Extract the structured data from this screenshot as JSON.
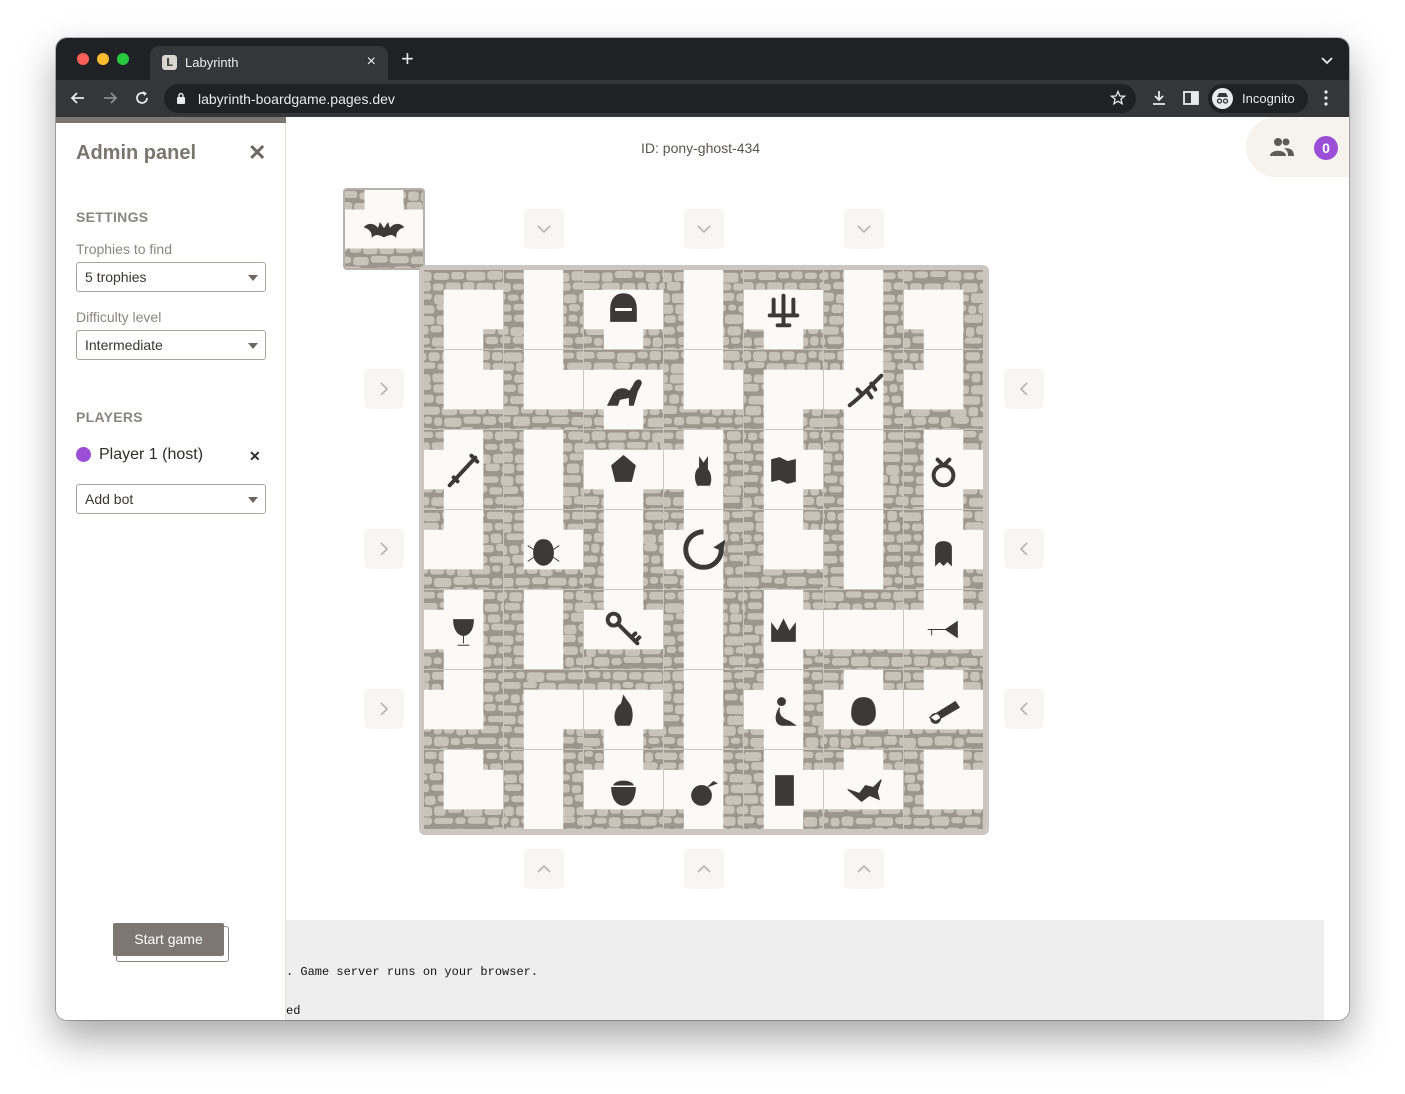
{
  "browser": {
    "tab_title": "Labyrinth",
    "tab_favicon": "L",
    "url": "labyrinth-boardgame.pages.dev",
    "profile_label": "Incognito"
  },
  "admin_panel": {
    "title": "Admin panel",
    "settings_heading": "SETTINGS",
    "trophies_label": "Trophies to find",
    "trophies_value": "5 trophies",
    "difficulty_label": "Difficulty level",
    "difficulty_value": "Intermediate",
    "players_heading": "PLAYERS",
    "players": [
      {
        "name": "Player 1 (host)",
        "color": "#9b4fd6"
      }
    ],
    "add_bot_value": "Add bot",
    "start_button": "Start game"
  },
  "game": {
    "id_label": "ID:",
    "id_value": "pony-ghost-434",
    "player_count": "0",
    "spare_tile": {
      "type": "T",
      "rotation": 180,
      "trophy": "bat"
    },
    "board": [
      [
        {
          "t": "L",
          "r": 90,
          "i": null
        },
        {
          "t": "I",
          "r": 0,
          "i": null
        },
        {
          "t": "T",
          "r": 0,
          "i": "helmet"
        },
        {
          "t": "I",
          "r": 0,
          "i": null
        },
        {
          "t": "T",
          "r": 0,
          "i": "candles"
        },
        {
          "t": "I",
          "r": 0,
          "i": null
        },
        {
          "t": "L",
          "r": 180,
          "i": null
        }
      ],
      [
        {
          "t": "L",
          "r": 0,
          "i": null
        },
        {
          "t": "L",
          "r": 0,
          "i": null
        },
        {
          "t": "T",
          "r": 0,
          "i": "dinosaur"
        },
        {
          "t": "L",
          "r": 0,
          "i": null
        },
        {
          "t": "L",
          "r": 90,
          "i": null
        },
        {
          "t": "T",
          "r": 90,
          "i": "lizard"
        },
        {
          "t": "L",
          "r": 270,
          "i": null
        }
      ],
      [
        {
          "t": "T",
          "r": 90,
          "i": "sword"
        },
        {
          "t": "I",
          "r": 0,
          "i": null
        },
        {
          "t": "T",
          "r": 0,
          "i": "gem"
        },
        {
          "t": "T",
          "r": 90,
          "i": "cat"
        },
        {
          "t": "T",
          "r": 270,
          "i": "map"
        },
        {
          "t": "I",
          "r": 0,
          "i": null
        },
        {
          "t": "T",
          "r": 270,
          "i": "ring"
        }
      ],
      [
        {
          "t": "L",
          "r": 270,
          "i": null
        },
        {
          "t": "L",
          "r": 0,
          "i": "beetle"
        },
        {
          "t": "I",
          "r": 0,
          "i": null
        },
        {
          "t": "T",
          "r": 90,
          "i": "rotate"
        },
        {
          "t": "L",
          "r": 0,
          "i": null
        },
        {
          "t": "I",
          "r": 0,
          "i": null
        },
        {
          "t": "T",
          "r": 270,
          "i": "ghost"
        }
      ],
      [
        {
          "t": "T",
          "r": 90,
          "i": "chalice"
        },
        {
          "t": "I",
          "r": 0,
          "i": null
        },
        {
          "t": "T",
          "r": 180,
          "i": "key"
        },
        {
          "t": "I",
          "r": 0,
          "i": null
        },
        {
          "t": "T",
          "r": 270,
          "i": "crown"
        },
        {
          "t": "I",
          "r": 90,
          "i": null
        },
        {
          "t": "T",
          "r": 180,
          "i": "trumpet"
        }
      ],
      [
        {
          "t": "L",
          "r": 270,
          "i": null
        },
        {
          "t": "L",
          "r": 90,
          "i": null
        },
        {
          "t": "T",
          "r": 0,
          "i": "mouse"
        },
        {
          "t": "I",
          "r": 0,
          "i": null
        },
        {
          "t": "T",
          "r": 90,
          "i": "mermaid"
        },
        {
          "t": "T",
          "r": 180,
          "i": "owl"
        },
        {
          "t": "T",
          "r": 180,
          "i": "cannon"
        }
      ],
      [
        {
          "t": "L",
          "r": 0,
          "i": null
        },
        {
          "t": "I",
          "r": 0,
          "i": null
        },
        {
          "t": "T",
          "r": 180,
          "i": "cauldron"
        },
        {
          "t": "T",
          "r": 90,
          "i": "bomb"
        },
        {
          "t": "T",
          "r": 270,
          "i": "book"
        },
        {
          "t": "T",
          "r": 180,
          "i": "dragon"
        },
        {
          "t": "L",
          "r": 0,
          "i": null
        }
      ]
    ],
    "colors": {
      "stone": "#c9c3ba",
      "stone_dark": "#9d968c",
      "path": "#fbfaf7",
      "icon": "#3b3a39"
    }
  },
  "log": {
    "lines": [
      ". Game server runs on your browser.",
      "ed"
    ]
  }
}
